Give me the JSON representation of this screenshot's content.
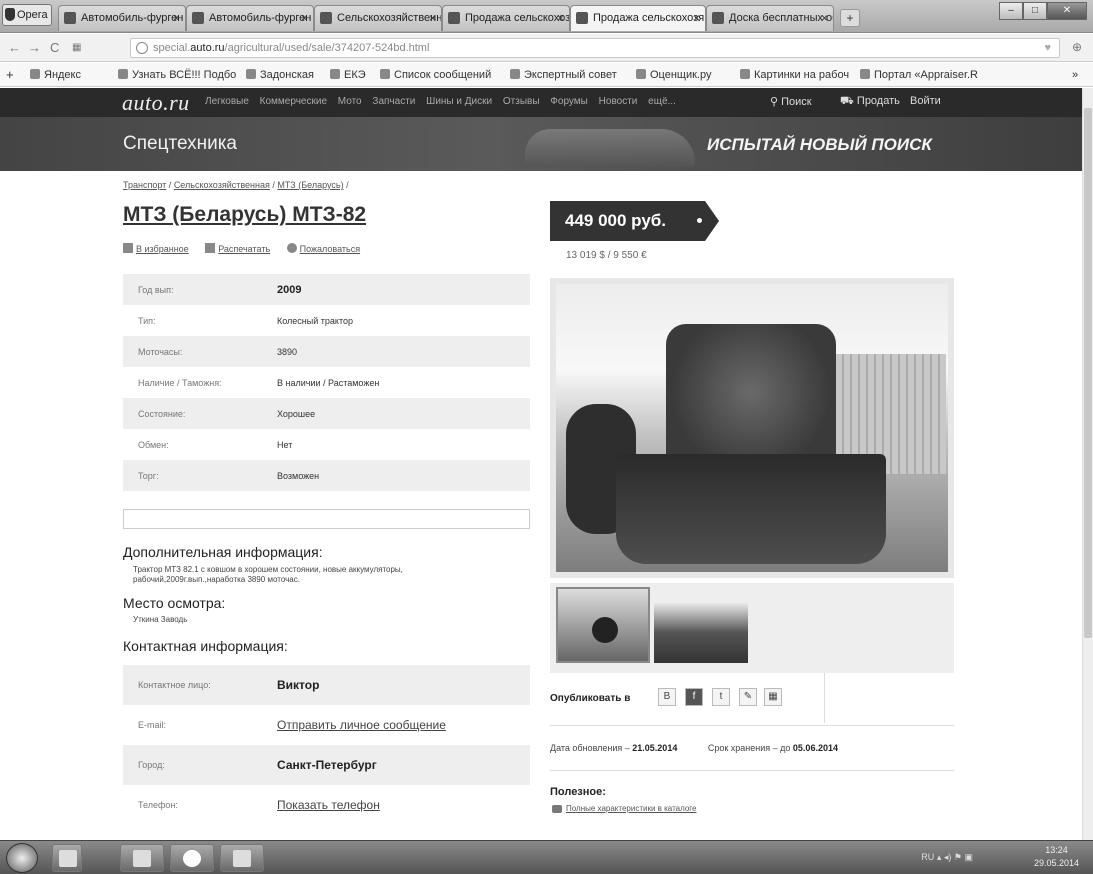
{
  "browser": {
    "app_button": "Opera",
    "tabs": [
      {
        "label": "Автомобиль-фурген"
      },
      {
        "label": "Автомобиль-фурген"
      },
      {
        "label": "Сельскохозяйственна"
      },
      {
        "label": "Продажа сельскохозя"
      },
      {
        "label": "Продажа сельскохозя",
        "active": true
      },
      {
        "label": "Доска бесплатных об"
      }
    ],
    "url_prefix": "special.",
    "url_domain": "auto.ru",
    "url_path": "/agricultural/used/sale/374207-524bd.html",
    "bookmarks": [
      "Яндекс",
      "Узнать ВСЁ!!! Подбо",
      "Задонская",
      "ЕКЭ",
      "Список сообщений",
      "Экспертный совет",
      "Оценщик.ру",
      "Картинки на рабоч",
      "Портал «Appraiser.R"
    ]
  },
  "site": {
    "logo": "auto.ru",
    "menu": [
      "Легковые",
      "Коммерческие",
      "Мото",
      "Запчасти",
      "Шины и Диски",
      "Отзывы",
      "Форумы",
      "Новости",
      "ещё..."
    ],
    "search": "Поиск",
    "sell": "Продать",
    "login": "Войти",
    "section_title": "Спецтехника",
    "banner": "ИСПЫТАЙ НОВЫЙ ПОИСК"
  },
  "breadcrumb": {
    "items": [
      "Транспорт",
      "Сельскохозяйственная",
      "МТЗ (Беларусь)"
    ],
    "sep": " / "
  },
  "listing": {
    "title": "МТЗ (Беларусь) МТЗ-82",
    "actions": {
      "favorite": "В избранное",
      "print": "Распечатать",
      "complain": "Пожаловаться"
    },
    "specs": [
      {
        "k": "Год вып:",
        "v": "2009"
      },
      {
        "k": "Тип:",
        "v": "Колесный трактор"
      },
      {
        "k": "Моточасы:",
        "v": "3890"
      },
      {
        "k": "Наличие / Таможня:",
        "v": "В наличии / Растаможен"
      },
      {
        "k": "Состояние:",
        "v": "Хорошее"
      },
      {
        "k": "Обмен:",
        "v": "Нет"
      },
      {
        "k": "Торг:",
        "v": "Возможен"
      }
    ],
    "extra_title": "Дополнительная информация:",
    "extra_text": "Трактор МТЗ 82.1 с ковшом в хорошем состоянии, новые аккумуляторы, рабочий,2009г.вып.,наработка 3890 моточас.",
    "place_title": "Место осмотра:",
    "place_text": "Уткина Заводь",
    "contact_title": "Контактная информация:",
    "contacts": [
      {
        "k": "Контактное лицо:",
        "v": "Виктор"
      },
      {
        "k": "E-mail:",
        "v": "Отправить личное сообщение"
      },
      {
        "k": "Город:",
        "v": "Санкт-Петербург"
      },
      {
        "k": "Телефон:",
        "v": "Показать телефон"
      }
    ],
    "price": "449 000 руб.",
    "price_conv": "13 019 $ / 9 550 €",
    "publish_label": "Опубликовать в",
    "updated_label": "Дата обновления – ",
    "updated_value": "21.05.2014",
    "expiry_label": "Срок хранения – до ",
    "expiry_value": "05.06.2014",
    "useful_title": "Полезное:",
    "useful_link": "Полные характеристики в каталоге"
  },
  "taskbar": {
    "lang": "RU",
    "time": "13:24",
    "date": "29.05.2014"
  }
}
